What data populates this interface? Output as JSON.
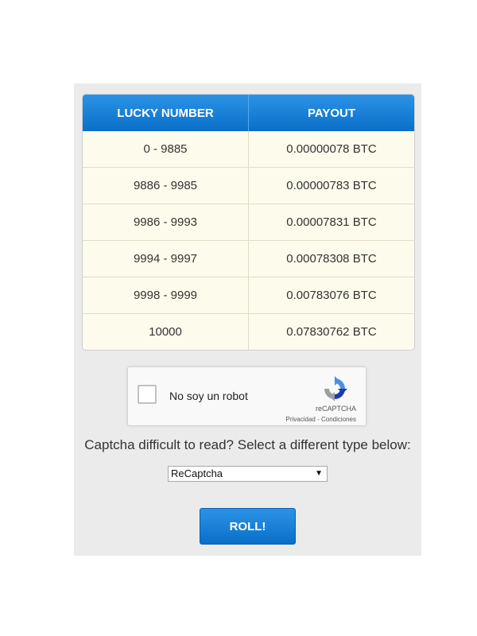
{
  "table": {
    "headers": [
      "LUCKY NUMBER",
      "PAYOUT"
    ],
    "rows": [
      {
        "range": "0 - 9885",
        "payout": "0.00000078 BTC"
      },
      {
        "range": "9886 - 9985",
        "payout": "0.00000783 BTC"
      },
      {
        "range": "9986 - 9993",
        "payout": "0.00007831 BTC"
      },
      {
        "range": "9994 - 9997",
        "payout": "0.00078308 BTC"
      },
      {
        "range": "9998 - 9999",
        "payout": "0.00783076 BTC"
      },
      {
        "range": "10000",
        "payout": "0.07830762 BTC"
      }
    ]
  },
  "captcha": {
    "label": "No soy un robot",
    "brand": "reCAPTCHA",
    "links": "Privacidad - Condiciones",
    "icon": "recaptcha-logo-icon"
  },
  "captcha_help": "Captcha difficult to read? Select a different type below:",
  "captcha_type": {
    "selected": "ReCaptcha"
  },
  "roll_label": "ROLL!",
  "colors": {
    "header_blue": "#1a7fd6",
    "row_bg": "#fdfbeb",
    "panel_bg": "#ebebeb"
  }
}
